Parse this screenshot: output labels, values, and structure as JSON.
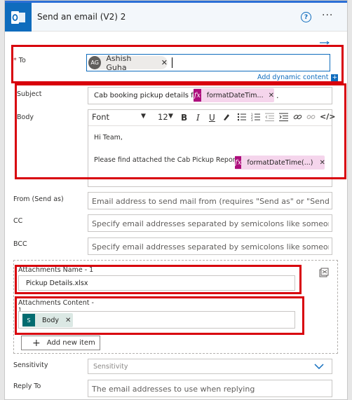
{
  "header": {
    "title": "Send an email (V2) 2",
    "help_icon": "?",
    "more_icon": "···"
  },
  "to": {
    "label": "To",
    "required_marker": "*",
    "recipient_initials": "AG",
    "recipient_name": "Ashish Guha",
    "add_dynamic_label": "Add dynamic content"
  },
  "subject": {
    "label": "Subject",
    "text": "Cab booking pickup details for :",
    "token_label": "formatDateTim...",
    "trailing": "."
  },
  "body": {
    "label": "Body",
    "font_select": "Font",
    "size_select": "12",
    "bold": "B",
    "italic": "I",
    "underline": "U",
    "greeting": "Hi Team,",
    "line2": "Please find attached the Cab Pickup Report for",
    "token_label": "formatDateTime(...)"
  },
  "from": {
    "label": "From (Send as)",
    "placeholder": "Email address to send mail from (requires \"Send as\" or \"Send on b..."
  },
  "cc": {
    "label": "CC",
    "placeholder": "Specify email addresses separated by semicolons like someone@c..."
  },
  "bcc": {
    "label": "BCC",
    "placeholder": "Specify email addresses separated by semicolons like someone@c..."
  },
  "attachments": {
    "name_label": "Attachments Name - 1",
    "name_value": "Pickup Details.xlsx",
    "content_label": "Attachments Content -",
    "content_label_suffix": "1",
    "content_token": "Body",
    "add_new_item": "Add new item"
  },
  "sensitivity": {
    "label": "Sensitivity",
    "placeholder": "Sensitivity"
  },
  "reply_to": {
    "label": "Reply To",
    "placeholder": "The email addresses to use when replying"
  },
  "colors": {
    "accent": "#0f6cbd",
    "highlight_red": "#d8000c",
    "token_pink": "#f5d5ec",
    "token_green": "#dbe8e4"
  }
}
